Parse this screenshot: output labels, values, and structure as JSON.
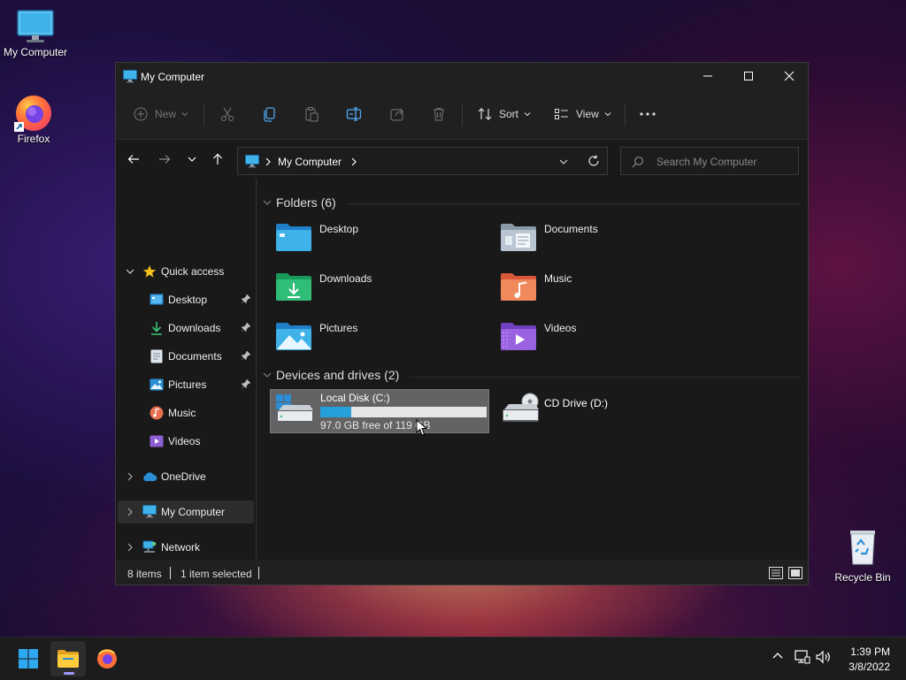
{
  "desktop": {
    "icons": [
      {
        "label": "My Computer"
      },
      {
        "label": "Firefox"
      },
      {
        "label": "Recycle Bin"
      }
    ]
  },
  "window": {
    "title": "My Computer",
    "controls": {
      "minimize": "minimize-icon",
      "maximize": "maximize-icon",
      "close": "close-icon"
    }
  },
  "toolbar": {
    "new_label": "New",
    "sort_label": "Sort",
    "view_label": "View"
  },
  "address": {
    "path": "My Computer",
    "search_placeholder": "Search My Computer"
  },
  "sidebar": {
    "quick_access": "Quick access",
    "pinned": [
      {
        "label": "Desktop",
        "pinned": true
      },
      {
        "label": "Downloads",
        "pinned": true
      },
      {
        "label": "Documents",
        "pinned": true
      },
      {
        "label": "Pictures",
        "pinned": true
      },
      {
        "label": "Music",
        "pinned": false
      },
      {
        "label": "Videos",
        "pinned": false
      }
    ],
    "onedrive": "OneDrive",
    "my_computer": "My Computer",
    "network": "Network"
  },
  "content": {
    "folders_header": "Folders (6)",
    "folders": [
      {
        "label": "Desktop"
      },
      {
        "label": "Documents"
      },
      {
        "label": "Downloads"
      },
      {
        "label": "Music"
      },
      {
        "label": "Pictures"
      },
      {
        "label": "Videos"
      }
    ],
    "drives_header": "Devices and drives (2)",
    "drives": [
      {
        "label": "Local Disk (C:)",
        "free_text": "97.0 GB free of 119 GB",
        "used_fraction": 0.185,
        "selected": true
      },
      {
        "label": "CD Drive (D:)"
      }
    ]
  },
  "status": {
    "items": "8 items",
    "selected": "1 item selected"
  },
  "taskbar": {
    "time": "1:39 PM",
    "date": "3/8/2022"
  },
  "colors": {
    "accent": "#26a0da",
    "window_bg": "#202020",
    "pane_bg": "#191919",
    "selected_drive_bg": "#636363"
  }
}
